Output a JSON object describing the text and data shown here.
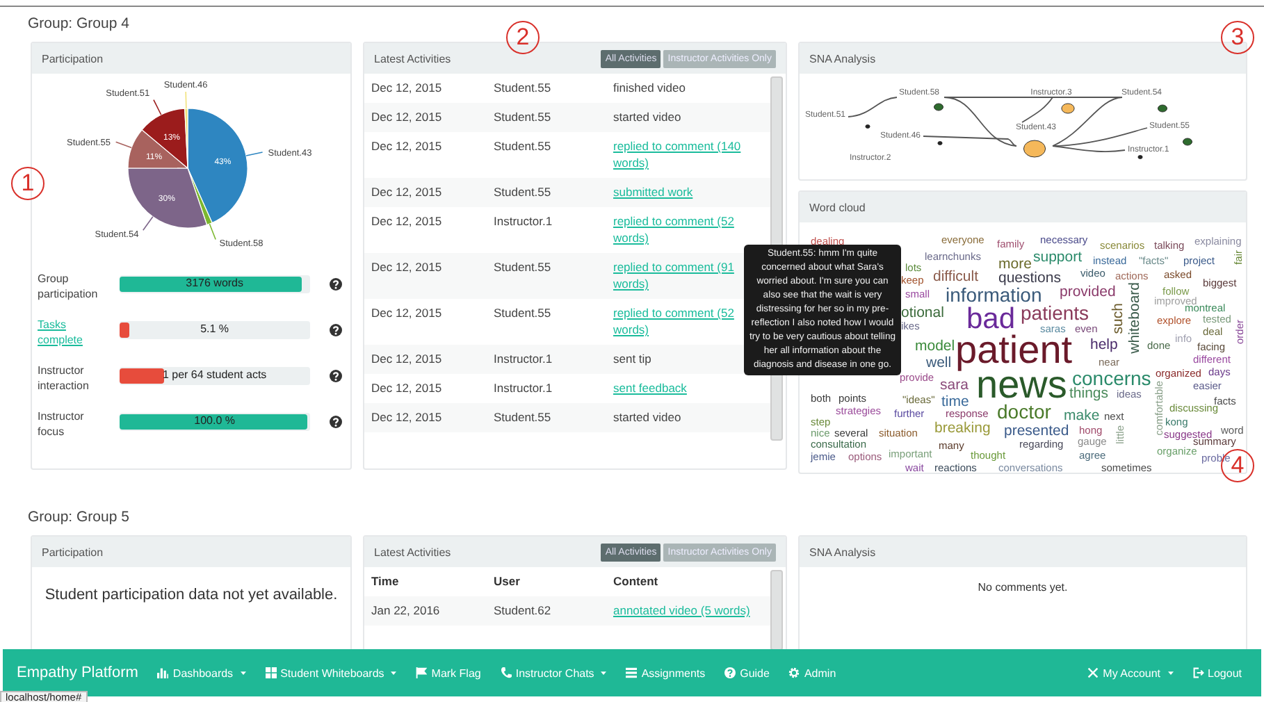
{
  "groups": [
    {
      "title": "Group: Group 4",
      "participation": {
        "title": "Participation",
        "chart_data": {
          "type": "pie",
          "categories": [
            "Student.43",
            "Student.58",
            "Student.54",
            "Student.55",
            "Student.51",
            "Student.46"
          ],
          "values": [
            43,
            1.5,
            30,
            11,
            13,
            0.8
          ],
          "colors": [
            "#2e86c1",
            "#7cb82f",
            "#7d6589",
            "#a8625e",
            "#9b1c1c",
            "#f1e27a"
          ],
          "value_labels": [
            "43%",
            null,
            "30%",
            "11%",
            "13%",
            null
          ]
        },
        "metrics": [
          {
            "label": "Group participation",
            "link": false,
            "level": 0.97,
            "reading": "3176 words",
            "color": "#1fb896"
          },
          {
            "label": "Tasks complete",
            "link": true,
            "level": 0.051,
            "reading": "5.1 %",
            "color": "#e74c3c"
          },
          {
            "label": "Instructor interaction",
            "link": false,
            "level": 0.24,
            "reading": "1 per 64 student acts",
            "color": "#e74c3c"
          },
          {
            "label": "Instructor focus",
            "link": false,
            "level": 1.0,
            "reading": "100.0 %",
            "color": "#1fb896"
          }
        ]
      },
      "activities": {
        "title": "Latest Activities",
        "filters": [
          {
            "label": "All Activities",
            "selected": true
          },
          {
            "label": "Instructor Activities Only",
            "selected": false
          }
        ],
        "rows": [
          {
            "date": "Dec 12, 2015",
            "user": "Student.55",
            "content": "finished video",
            "link": false
          },
          {
            "date": "Dec 12, 2015",
            "user": "Student.55",
            "content": "started video",
            "link": false
          },
          {
            "date": "Dec 12, 2015",
            "user": "Student.55",
            "content": "replied to comment (140 words)",
            "link": true
          },
          {
            "date": "Dec 12, 2015",
            "user": "Student.55",
            "content": "submitted work",
            "link": true
          },
          {
            "date": "Dec 12, 2015",
            "user": "Instructor.1",
            "content": "replied to comment (52 words)",
            "link": true
          },
          {
            "date": "Dec 12, 2015",
            "user": "Student.55",
            "content": "replied to comment (91 words)",
            "link": true
          },
          {
            "date": "Dec 12, 2015",
            "user": "Student.55",
            "content": "replied to comment (52 words)",
            "link": true
          },
          {
            "date": "Dec 12, 2015",
            "user": "Instructor.1",
            "content": "sent tip",
            "link": false
          },
          {
            "date": "Dec 12, 2015",
            "user": "Instructor.1",
            "content": "sent feedback",
            "link": true
          },
          {
            "date": "Dec 12, 2015",
            "user": "Student.55",
            "content": "started video",
            "link": false
          }
        ]
      },
      "sna": {
        "title": "SNA Analysis",
        "nodes": [
          {
            "label": "Student.51",
            "kind": "dot",
            "color": "#222222"
          },
          {
            "label": "Student.58",
            "kind": "small",
            "color": "#2e6b2e"
          },
          {
            "label": "Instructor.3",
            "kind": "medium",
            "color": "#f5b85a"
          },
          {
            "label": "Student.54",
            "kind": "small",
            "color": "#2e6b2e"
          },
          {
            "label": "Student.46",
            "kind": "dot",
            "color": "#222222"
          },
          {
            "label": "Student.43",
            "kind": "large",
            "color": "#f5b85a"
          },
          {
            "label": "Student.55",
            "kind": "small",
            "color": "#2e6b2e"
          },
          {
            "label": "Instructor.1",
            "kind": "dot",
            "color": "#222222"
          },
          {
            "label": "Instructor.2",
            "kind": "none"
          }
        ]
      },
      "word_cloud": {
        "title": "Word cloud",
        "words": [
          {
            "text": "dealing",
            "color": "#c0504d",
            "kind": "xs",
            "vertical": false
          },
          {
            "text": "everyone",
            "color": "#8a6d3b",
            "kind": "xs",
            "vertical": false
          },
          {
            "text": "family",
            "color": "#a05070",
            "kind": "xs",
            "vertical": false
          },
          {
            "text": "necessary",
            "color": "#4a4a8a",
            "kind": "xs",
            "vertical": false
          },
          {
            "text": "scenarios",
            "color": "#8a8a3a",
            "kind": "xs",
            "vertical": false
          },
          {
            "text": "talking",
            "color": "#7a4a5a",
            "kind": "xs",
            "vertical": false
          },
          {
            "text": "explaining",
            "color": "#8a8aa0",
            "kind": "xs",
            "vertical": false
          },
          {
            "text": "lots",
            "color": "#5a8a3a",
            "kind": "xs",
            "vertical": false
          },
          {
            "text": "learnchunks",
            "color": "#6a6a8a",
            "kind": "xs",
            "vertical": false
          },
          {
            "text": "more",
            "color": "#6a6a2a",
            "kind": "s",
            "vertical": false
          },
          {
            "text": "support",
            "color": "#2a8a6a",
            "kind": "s",
            "vertical": false
          },
          {
            "text": "instead",
            "color": "#3a6a9a",
            "kind": "xs",
            "vertical": false
          },
          {
            "text": "\"facts\"",
            "color": "#6a8a8a",
            "kind": "xs",
            "vertical": false
          },
          {
            "text": "project",
            "color": "#3a5a8a",
            "kind": "xs",
            "vertical": false
          },
          {
            "text": "fair",
            "color": "#6a8a3a",
            "kind": "xs",
            "vertical": true
          },
          {
            "text": "keep",
            "color": "#a0502a",
            "kind": "xs",
            "vertical": false
          },
          {
            "text": "difficult",
            "color": "#8a5a4a",
            "kind": "s",
            "vertical": false
          },
          {
            "text": "questions",
            "color": "#3a3a4a",
            "kind": "s",
            "vertical": false
          },
          {
            "text": "video",
            "color": "#3a5a6a",
            "kind": "xs",
            "vertical": false
          },
          {
            "text": "actions",
            "color": "#a06a5a",
            "kind": "xs",
            "vertical": false
          },
          {
            "text": "asked",
            "color": "#7a4a2a",
            "kind": "xs",
            "vertical": false
          },
          {
            "text": "biggest",
            "color": "#5a3a3a",
            "kind": "xs",
            "vertical": false
          },
          {
            "text": "small",
            "color": "#9a4aa0",
            "kind": "xs",
            "vertical": false
          },
          {
            "text": "information",
            "color": "#3a5a7a",
            "kind": "m",
            "vertical": false
          },
          {
            "text": "provided",
            "color": "#8a3a6a",
            "kind": "s",
            "vertical": false
          },
          {
            "text": "whiteboard",
            "color": "#3a5a4a",
            "kind": "s",
            "vertical": true
          },
          {
            "text": "follow",
            "color": "#7a9a4a",
            "kind": "xs",
            "vertical": false
          },
          {
            "text": "improved",
            "color": "#a0a0a0",
            "kind": "xs",
            "vertical": false
          },
          {
            "text": "otional",
            "color": "#3a6a3a",
            "kind": "s",
            "vertical": false
          },
          {
            "text": "bad",
            "color": "#6a2a9a",
            "kind": "l",
            "vertical": false
          },
          {
            "text": "patients",
            "color": "#8a3a5a",
            "kind": "m",
            "vertical": false
          },
          {
            "text": "such",
            "color": "#6a5a2a",
            "kind": "s",
            "vertical": true
          },
          {
            "text": "explore",
            "color": "#b0502a",
            "kind": "xs",
            "vertical": false
          },
          {
            "text": "montreal",
            "color": "#3a8a5a",
            "kind": "xs",
            "vertical": false
          },
          {
            "text": "order",
            "color": "#8a4a9a",
            "kind": "xs",
            "vertical": true
          },
          {
            "text": "tested",
            "color": "#7a9a7a",
            "kind": "xs",
            "vertical": false
          },
          {
            "text": "ikes",
            "color": "#6a6a8a",
            "kind": "xs",
            "vertical": false
          },
          {
            "text": "saras",
            "color": "#5a8aa0",
            "kind": "xs",
            "vertical": false
          },
          {
            "text": "even",
            "color": "#7a4a7a",
            "kind": "xs",
            "vertical": false
          },
          {
            "text": "patient",
            "color": "#6a1a2a",
            "kind": "xl",
            "vertical": false
          },
          {
            "text": "info",
            "color": "#a0a0b0",
            "kind": "xs",
            "vertical": false
          },
          {
            "text": "deal",
            "color": "#6a6a3a",
            "kind": "xs",
            "vertical": false
          },
          {
            "text": "model",
            "color": "#3a8a3a",
            "kind": "s",
            "vertical": false
          },
          {
            "text": "help",
            "color": "#4a2a6a",
            "kind": "s",
            "vertical": false
          },
          {
            "text": "done",
            "color": "#4a6a4a",
            "kind": "xs",
            "vertical": false
          },
          {
            "text": "facing",
            "color": "#5a4a3a",
            "kind": "xs",
            "vertical": false
          },
          {
            "text": "well",
            "color": "#3a5a7a",
            "kind": "s",
            "vertical": false
          },
          {
            "text": "near",
            "color": "#7a6a5a",
            "kind": "xs",
            "vertical": false
          },
          {
            "text": "different",
            "color": "#9a4aa0",
            "kind": "xs",
            "vertical": false
          },
          {
            "text": "provide",
            "color": "#9a4a8a",
            "kind": "xs",
            "vertical": false
          },
          {
            "text": "news",
            "color": "#2a5a2a",
            "kind": "xl",
            "vertical": false
          },
          {
            "text": "concerns",
            "color": "#2a8a6a",
            "kind": "m",
            "vertical": false
          },
          {
            "text": "organized",
            "color": "#8a2a2a",
            "kind": "xs",
            "vertical": false
          },
          {
            "text": "days",
            "color": "#6a3a8a",
            "kind": "xs",
            "vertical": false
          },
          {
            "text": "sara",
            "color": "#8a4a7a",
            "kind": "s",
            "vertical": false
          },
          {
            "text": "things",
            "color": "#4a8a5a",
            "kind": "s",
            "vertical": false
          },
          {
            "text": "ideas",
            "color": "#6a6a8a",
            "kind": "xs",
            "vertical": false
          },
          {
            "text": "comfortable",
            "color": "#8aa08a",
            "kind": "xs",
            "vertical": true
          },
          {
            "text": "easier",
            "color": "#5a5a8a",
            "kind": "xs",
            "vertical": false
          },
          {
            "text": "both",
            "color": "#3a3a3a",
            "kind": "xs",
            "vertical": false
          },
          {
            "text": "points",
            "color": "#3a3a3a",
            "kind": "xs",
            "vertical": false
          },
          {
            "text": "\"ideas\"",
            "color": "#6a6a3a",
            "kind": "xs",
            "vertical": false
          },
          {
            "text": "time",
            "color": "#3a6a9a",
            "kind": "s",
            "vertical": false
          },
          {
            "text": "doctor",
            "color": "#4a7a2a",
            "kind": "m",
            "vertical": false
          },
          {
            "text": "facts",
            "color": "#4a4a4a",
            "kind": "xs",
            "vertical": false
          },
          {
            "text": "strategies",
            "color": "#9a4a9a",
            "kind": "xs",
            "vertical": false
          },
          {
            "text": "further",
            "color": "#5a4aa0",
            "kind": "xs",
            "vertical": false
          },
          {
            "text": "response",
            "color": "#8a3a6a",
            "kind": "xs",
            "vertical": false
          },
          {
            "text": "make",
            "color": "#3a8a6a",
            "kind": "s",
            "vertical": false
          },
          {
            "text": "next",
            "color": "#4a4a4a",
            "kind": "xs",
            "vertical": false
          },
          {
            "text": "discussing",
            "color": "#6a8a3a",
            "kind": "xs",
            "vertical": false
          },
          {
            "text": "step",
            "color": "#6a8a3a",
            "kind": "xs",
            "vertical": false
          },
          {
            "text": "breaking",
            "color": "#9a9a3a",
            "kind": "s",
            "vertical": false
          },
          {
            "text": "kong",
            "color": "#3a7a6a",
            "kind": "xs",
            "vertical": false
          },
          {
            "text": "nice",
            "color": "#6a9a6a",
            "kind": "xs",
            "vertical": false
          },
          {
            "text": "several",
            "color": "#3a3a3a",
            "kind": "xs",
            "vertical": false
          },
          {
            "text": "situation",
            "color": "#8a5a2a",
            "kind": "xs",
            "vertical": false
          },
          {
            "text": "presented",
            "color": "#3a5a8a",
            "kind": "s",
            "vertical": false
          },
          {
            "text": "hong",
            "color": "#a04a6a",
            "kind": "xs",
            "vertical": false
          },
          {
            "text": "little",
            "color": "#8aa08a",
            "kind": "xs",
            "vertical": true
          },
          {
            "text": "suggested",
            "color": "#8a3a8a",
            "kind": "xs",
            "vertical": false
          },
          {
            "text": "word",
            "color": "#5a5a5a",
            "kind": "xs",
            "vertical": false
          },
          {
            "text": "consultation",
            "color": "#3a6a4a",
            "kind": "xs",
            "vertical": false
          },
          {
            "text": "many",
            "color": "#5a3a2a",
            "kind": "xs",
            "vertical": false
          },
          {
            "text": "regarding",
            "color": "#4a4a5a",
            "kind": "xs",
            "vertical": false
          },
          {
            "text": "gauge",
            "color": "#8a8a8a",
            "kind": "xs",
            "vertical": false
          },
          {
            "text": "summary",
            "color": "#5a3a3a",
            "kind": "xs",
            "vertical": false
          },
          {
            "text": "jemie",
            "color": "#4a5a8a",
            "kind": "xs",
            "vertical": false
          },
          {
            "text": "options",
            "color": "#9a5a7a",
            "kind": "xs",
            "vertical": false
          },
          {
            "text": "important",
            "color": "#7aa07a",
            "kind": "xs",
            "vertical": false
          },
          {
            "text": "thought",
            "color": "#6a9a3a",
            "kind": "xs",
            "vertical": false
          },
          {
            "text": "agree",
            "color": "#4a6a7a",
            "kind": "xs",
            "vertical": false
          },
          {
            "text": "organize",
            "color": "#6aa06a",
            "kind": "xs",
            "vertical": false
          },
          {
            "text": "proble",
            "color": "#6a6aa0",
            "kind": "xs",
            "vertical": false
          },
          {
            "text": "wait",
            "color": "#8a4aa0",
            "kind": "xs",
            "vertical": false
          },
          {
            "text": "reactions",
            "color": "#3a4a5a",
            "kind": "xs",
            "vertical": false
          },
          {
            "text": "conversations",
            "color": "#7a8aa0",
            "kind": "xs",
            "vertical": false
          },
          {
            "text": "sometimes",
            "color": "#4a4a4a",
            "kind": "xs",
            "vertical": false
          }
        ]
      },
      "tooltip": {
        "text": "Student.55: hmm I'm quite concerned about what Sara's worried about. I'm sure you can also see that the wait is very distressing for her so in my pre-reflection I also noted how I would try to be very cautious about telling her all information about the diagnosis and disease in one go."
      }
    },
    {
      "title": "Group: Group 5",
      "participation": {
        "title": "Participation",
        "message": "Student participation data not yet available."
      },
      "activities": {
        "title": "Latest Activities",
        "filters": [
          {
            "label": "All Activities",
            "selected": true
          },
          {
            "label": "Instructor Activities Only",
            "selected": false
          }
        ],
        "columns": [
          "Time",
          "User",
          "Content"
        ],
        "rows": [
          {
            "date": "Jan 22, 2016",
            "user": "Student.62",
            "content": "annotated video (5 words)",
            "link": true
          }
        ]
      },
      "sna": {
        "title": "SNA Analysis",
        "message": "No comments yet."
      }
    }
  ],
  "annotations": [
    "1",
    "2",
    "3",
    "4"
  ],
  "navbar": {
    "brand": "Empathy Platform",
    "items": [
      {
        "label": "Dashboards",
        "dropdown": true
      },
      {
        "label": "Student Whiteboards",
        "dropdown": true
      },
      {
        "label": "Mark Flag",
        "dropdown": false
      },
      {
        "label": "Instructor Chats",
        "dropdown": true
      },
      {
        "label": "Assignments",
        "dropdown": false
      },
      {
        "label": "Guide",
        "dropdown": false
      },
      {
        "label": "Admin",
        "dropdown": false
      }
    ],
    "right_items": [
      {
        "label": "My Account",
        "dropdown": true
      },
      {
        "label": "Logout",
        "dropdown": false
      }
    ]
  },
  "status_bar": "localhost/home#"
}
